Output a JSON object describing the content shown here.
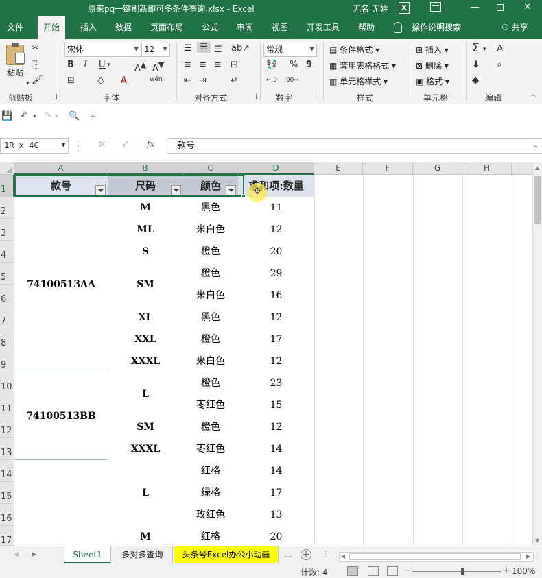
{
  "window": {
    "title": "原来pq一键刷新即可多条件查询.xlsx  -  Excel",
    "user": "无名 无姓",
    "app_icon_letter": "X",
    "minimize": "—",
    "close": "✕"
  },
  "tabs": [
    {
      "label": "文件"
    },
    {
      "label": "开始"
    },
    {
      "label": "插入"
    },
    {
      "label": "数据"
    },
    {
      "label": "页面布局"
    },
    {
      "label": "公式"
    },
    {
      "label": "审阅"
    },
    {
      "label": "视图"
    },
    {
      "label": "开发工具"
    },
    {
      "label": "帮助"
    }
  ],
  "tell_me": "操作说明搜索",
  "share": "共享",
  "ribbon": {
    "clipboard": {
      "label": "剪贴板",
      "paste": "粘贴"
    },
    "font": {
      "label": "字体",
      "name": "宋体",
      "size": "12",
      "bold": "B",
      "italic": "I",
      "underline": "U",
      "color_a": "A",
      "phonetic": "wén"
    },
    "alignment": {
      "label": "对齐方式"
    },
    "number": {
      "label": "数字",
      "format": "常规",
      "percent": "%",
      "comma": "9"
    },
    "styles": {
      "label": "样式",
      "conditional": "条件格式",
      "table": "套用表格格式",
      "cell": "单元格样式"
    },
    "cells": {
      "label": "单元格",
      "insert": "插入",
      "delete": "删除",
      "format": "格式"
    },
    "editing": {
      "label": "编辑",
      "sum": "Σ",
      "sort": "A",
      "find": "⌕"
    }
  },
  "formula_bar": {
    "name_box": "1R x 4C",
    "cancel": "✕",
    "enter": "✓",
    "fx": "fx",
    "content": "款号"
  },
  "columns": [
    {
      "name": "A",
      "width": 136
    },
    {
      "name": "B",
      "width": 110
    },
    {
      "name": "C",
      "width": 80
    },
    {
      "name": "D",
      "width": 110
    },
    {
      "name": "E",
      "width": 71
    },
    {
      "name": "F",
      "width": 72
    },
    {
      "name": "G",
      "width": 72
    },
    {
      "name": "H",
      "width": 72
    }
  ],
  "rows": [
    "1",
    "2",
    "3",
    "4",
    "5",
    "6",
    "7",
    "8",
    "9",
    "10",
    "11",
    "12",
    "13",
    "14",
    "15",
    "16",
    "17"
  ],
  "table": {
    "headers": [
      "款号",
      "尺码",
      "颜色",
      "求和项:数量"
    ],
    "styles": [
      {
        "label": "74100513AA"
      },
      {
        "label": "74100513BB"
      }
    ],
    "sizes": [
      "M",
      "ML",
      "S",
      "SM",
      "XL",
      "XXL",
      "XXXL",
      "L",
      "SM",
      "XXXL",
      "L",
      "M"
    ],
    "colors": [
      "黑色",
      "米白色",
      "橙色",
      "橙色",
      "米白色",
      "黑色",
      "橙色",
      "米白色",
      "橙色",
      "枣红色",
      "橙色",
      "枣红色",
      "红格",
      "绿格",
      "玫红色",
      "红格"
    ],
    "quantities": [
      "11",
      "12",
      "20",
      "29",
      "16",
      "12",
      "17",
      "12",
      "23",
      "15",
      "12",
      "14",
      "14",
      "17",
      "13",
      "20"
    ]
  },
  "sheets": [
    {
      "label": "Sheet1"
    },
    {
      "label": "多对多查询"
    },
    {
      "label": "头条号Excel办公小动画"
    }
  ],
  "sheet_more": "...",
  "status": {
    "count": "计数: 4",
    "zoom": "100%"
  },
  "colors": {
    "accent": "#217346",
    "highlight": "#ffff00"
  }
}
